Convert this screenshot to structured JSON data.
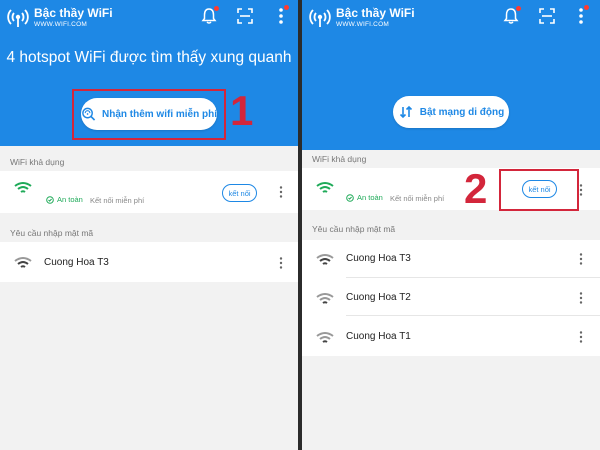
{
  "app": {
    "title": "Bậc thầy WiFi",
    "url": "WWW.WIFI.COM"
  },
  "left_panel": {
    "headline": "4 hotspot WiFi được tìm thấy xung quanh",
    "main_button_label": "Nhận thêm wifi miễn phí",
    "step_number": "1",
    "available_label": "WiFi khả dụng",
    "available_network": {
      "badge": "An toàn",
      "free_text": "Kết nối miễn phí",
      "connect_label": "kết nối"
    },
    "password_label": "Yêu cầu nhập mật mã",
    "password_networks": [
      {
        "name": "Cuong Hoa T3"
      }
    ]
  },
  "right_panel": {
    "main_button_label": "Bật mạng di động",
    "step_number": "2",
    "available_label": "WiFi khả dụng",
    "available_network": {
      "badge": "An toàn",
      "free_text": "Kết nối miễn phí",
      "connect_label": "kết nối"
    },
    "password_label": "Yêu cầu nhập mật mã",
    "password_networks": [
      {
        "name": "Cuong Hoa T3"
      },
      {
        "name": "Cuong Hoa T2"
      },
      {
        "name": "Cuong Hoa T1"
      }
    ]
  },
  "colors": {
    "brand_blue": "#1e88e5",
    "highlight_red": "#d3263b",
    "safe_green": "#1faa59"
  },
  "icons": [
    "wifi-logo-icon",
    "bell-icon",
    "scan-icon",
    "more-icon",
    "search-wifi-icon",
    "mobile-data-icon",
    "wifi-signal-icon",
    "shield-check-icon"
  ]
}
